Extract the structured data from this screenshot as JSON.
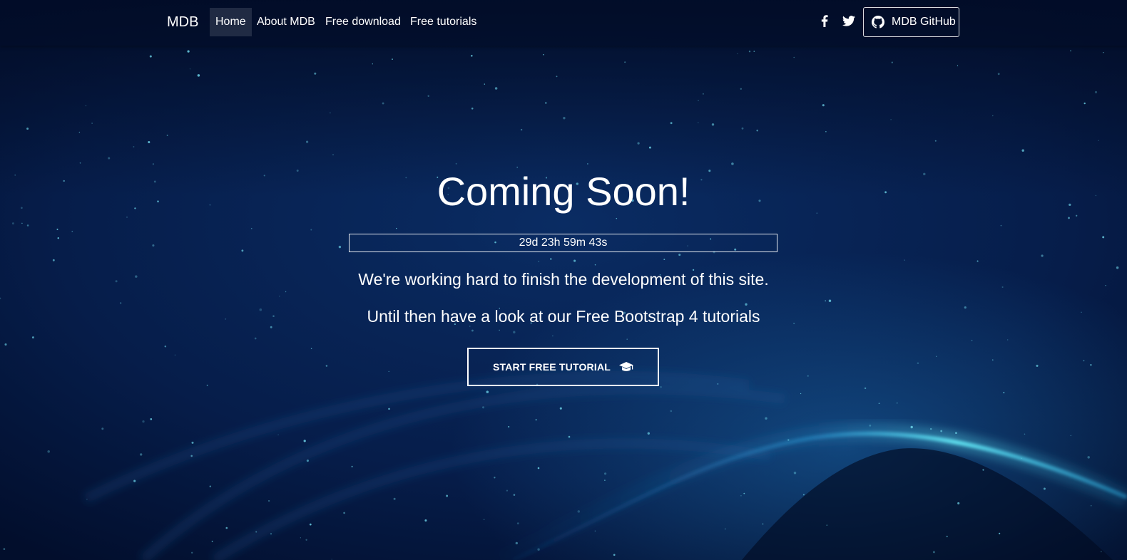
{
  "navbar": {
    "brand": "MDB",
    "links": [
      {
        "label": "Home",
        "active": true
      },
      {
        "label": "About MDB",
        "active": false
      },
      {
        "label": "Free download",
        "active": false
      },
      {
        "label": "Free tutorials",
        "active": false
      }
    ],
    "social": [
      {
        "icon": "facebook-icon"
      },
      {
        "icon": "twitter-icon"
      }
    ],
    "github_button": {
      "label": "MDB GitHub",
      "icon": "github-icon"
    }
  },
  "hero": {
    "title": "Coming Soon!",
    "countdown": "29d 23h 59m 43s",
    "line1": "We're working hard to finish the development of this site.",
    "line2": "Until then have a look at our Free Bootstrap 4 tutorials",
    "cta": {
      "label": "START FREE TUTORIAL",
      "icon": "graduation-cap-icon"
    }
  },
  "colors": {
    "background_dark": "#02102e",
    "background_mid": "#06255a",
    "wave_glow": "#3fd3e6",
    "text": "#ffffff"
  }
}
